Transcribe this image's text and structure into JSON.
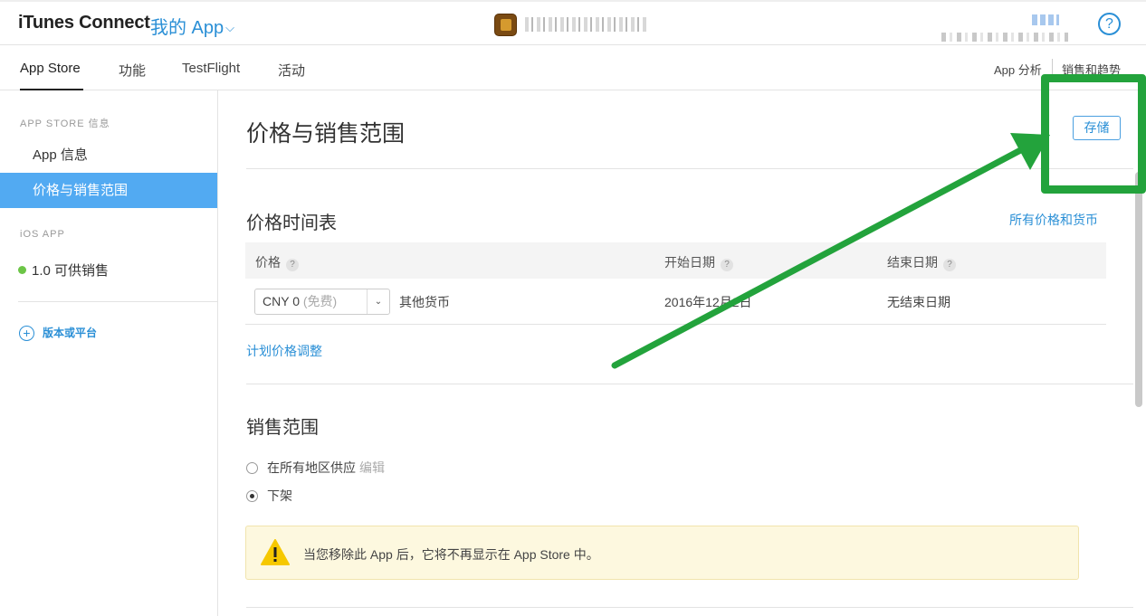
{
  "header": {
    "brand": "iTunes Connect",
    "my_app": "我的 App",
    "help_icon_text": "?"
  },
  "subnav": {
    "tabs": [
      "App Store",
      "功能",
      "TestFlight",
      "活动"
    ],
    "right_links": [
      "App 分析",
      "销售和趋势"
    ]
  },
  "sidebar": {
    "section1_heading": "APP STORE 信息",
    "items": [
      "App 信息",
      "价格与销售范围"
    ],
    "section2_heading": "iOS APP",
    "version_status": "1.0 可供销售",
    "add_platform": "版本或平台"
  },
  "main": {
    "title": "价格与销售范围",
    "save_label": "存储",
    "schedule_title": "价格时间表",
    "all_prices_link": "所有价格和货币",
    "columns": [
      "价格",
      "开始日期",
      "结束日期"
    ],
    "price_value": "CNY 0",
    "price_note": "(免费)",
    "other_currency": "其他货币",
    "start_date": "2016年12月2日",
    "end_date": "无结束日期",
    "plan_adjust": "计划价格调整",
    "availability_title": "销售范围",
    "option_all_regions": "在所有地区供应",
    "option_edit": "编辑",
    "option_remove": "下架",
    "selected_option": "下架",
    "warning_text": "当您移除此 App 后，它将不再显示在 App Store 中。"
  },
  "colors": {
    "link_blue": "#2a8fd6",
    "sidebar_active": "#52aaf2",
    "status_green": "#6cc547",
    "annotation_green": "#23a33c",
    "warning_bg": "#fdf8df"
  }
}
